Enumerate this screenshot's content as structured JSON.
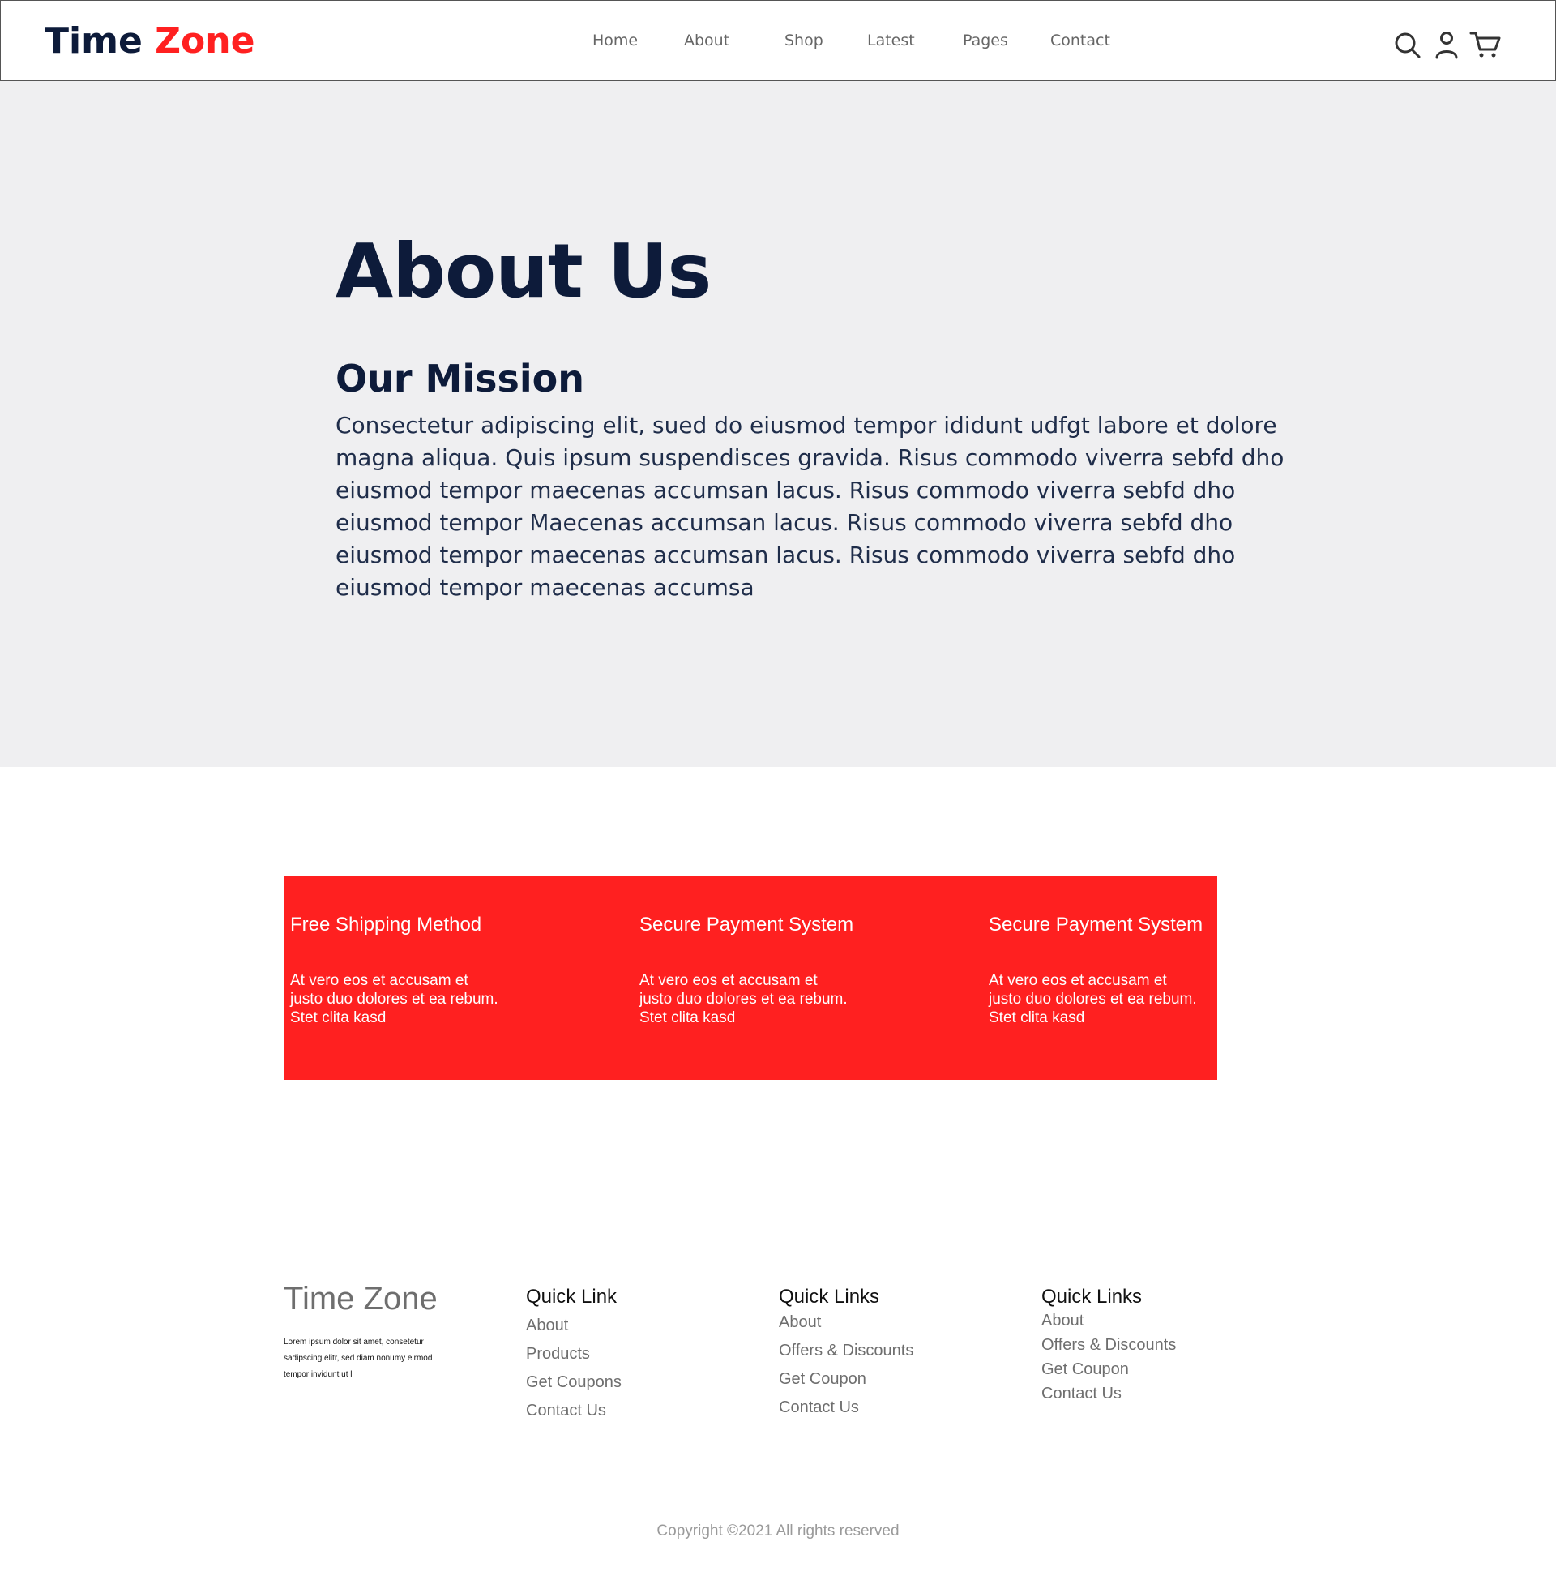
{
  "header": {
    "logo_main": "Time",
    "logo_accent": "Zone",
    "nav": [
      "Home",
      "About",
      "Shop",
      "Latest",
      "Pages",
      "Contact"
    ],
    "icons": [
      "search-icon",
      "user-icon",
      "cart-icon"
    ]
  },
  "hero": {
    "title": "About Us",
    "subtitle": "Our Mission",
    "body": "Consectetur adipiscing elit, sued do eiusmod tempor ididunt udfgt labore et dolore magna aliqua. Quis ipsum suspendisces gravida. Risus commodo viverra sebfd dho eiusmod tempor maecenas accumsan lacus. Risus commodo viverra sebfd dho eiusmod tempor Maecenas accumsan lacus. Risus commodo viverra sebfd dho eiusmod tempor maecenas accumsan lacus. Risus commodo viverra sebfd dho eiusmod tempor maecenas accumsa"
  },
  "features": [
    {
      "title": "Free Shipping Method",
      "desc": " At vero eos et accusam et justo duo dolores et ea rebum. Stet clita kasd"
    },
    {
      "title": "Secure Payment System",
      "desc": " At vero eos et accusam et justo duo dolores et ea rebum. Stet clita kasd"
    },
    {
      "title": "Secure Payment System",
      "desc": " At vero eos et accusam et justo duo dolores et ea rebum. Stet clita kasd"
    }
  ],
  "footer": {
    "brand": "Time Zone",
    "desc": "Lorem ipsum dolor sit amet, consetetur sadipscing elitr, sed diam nonumy eirmod tempor invidunt ut l",
    "columns": [
      {
        "heading": "Quick Link",
        "links": [
          "About",
          "Products",
          "Get Coupons",
          "Contact Us"
        ]
      },
      {
        "heading": "Quick Links",
        "links": [
          "About",
          "Offers & Discounts",
          "Get Coupon",
          "Contact Us"
        ]
      },
      {
        "heading": "Quick Links",
        "links": [
          "About",
          "Offers & Discounts",
          "Get Coupon",
          "Contact Us"
        ]
      }
    ],
    "copyright": "Copyright ©2021 All rights reserved"
  },
  "colors": {
    "accent": "#ff2020",
    "navy": "#0d1b3a",
    "hero_bg": "#efeff1"
  }
}
